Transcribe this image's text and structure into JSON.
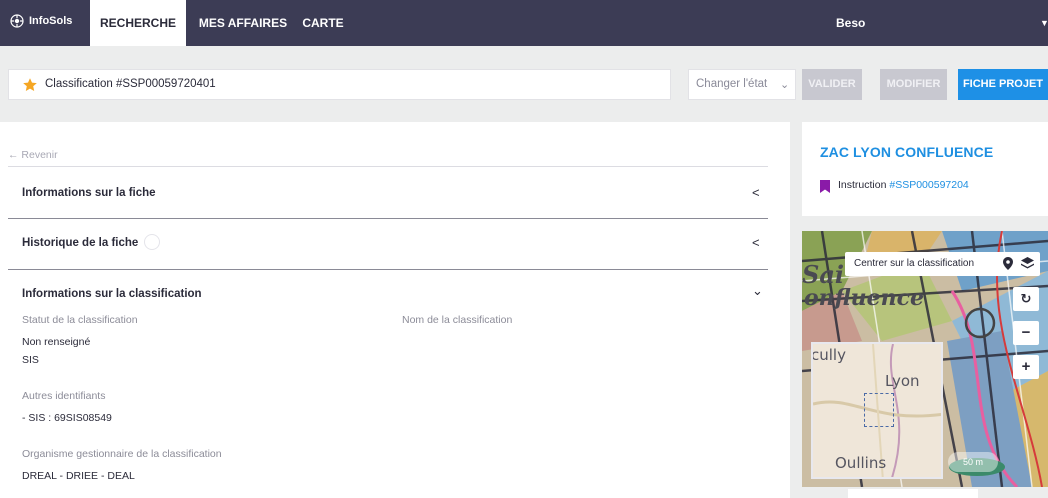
{
  "nav": {
    "brand": "InfoSols",
    "tabs": [
      {
        "label": "RECHERCHE",
        "active": true
      },
      {
        "label": "MES AFFAIRES",
        "active": false
      },
      {
        "label": "CARTE",
        "active": false
      }
    ],
    "user": "Beso"
  },
  "header": {
    "title": "Classification #SSP00059720401",
    "state_select": "Changer l'état",
    "buttons": {
      "valider": "VALIDER",
      "modifier": "MODIFIER",
      "fiche_projet": "FICHE PROJET"
    }
  },
  "left": {
    "back": "← Revenir",
    "sections": [
      {
        "title": "Informations sur la fiche",
        "chevron": "<"
      },
      {
        "title": "Historique de la fiche",
        "chevron": "<"
      },
      {
        "title": "Informations sur la classification",
        "chevron": "⌄"
      }
    ],
    "fields": {
      "statut_label": "Statut de la classification",
      "nom_label": "Nom de la classification",
      "statut_value": "Non renseigné",
      "statut_value2": "SIS",
      "autres_label": "Autres identifiants",
      "autres_value": "- SIS : 69SIS08549",
      "organisme_label": "Organisme gestionnaire de la classification",
      "organisme_value": "DREAL - DRIEE - DEAL"
    }
  },
  "project_card": {
    "title": "ZAC LYON CONFLUENCE",
    "instruction_prefix": "Instruction ",
    "instruction_link": "#SSP000597204"
  },
  "map": {
    "center_button": "Centrer sur la classification",
    "inset_labels": [
      "cully",
      "Lyon",
      "Oullins"
    ],
    "bg_labels": [
      "Sai",
      "onfluence"
    ],
    "scale": "50 m",
    "colors": {
      "accent": "#1e90e6",
      "nav": "#3c3c55",
      "star": "#f5a623",
      "bookmark": "#8a1aa8"
    }
  }
}
